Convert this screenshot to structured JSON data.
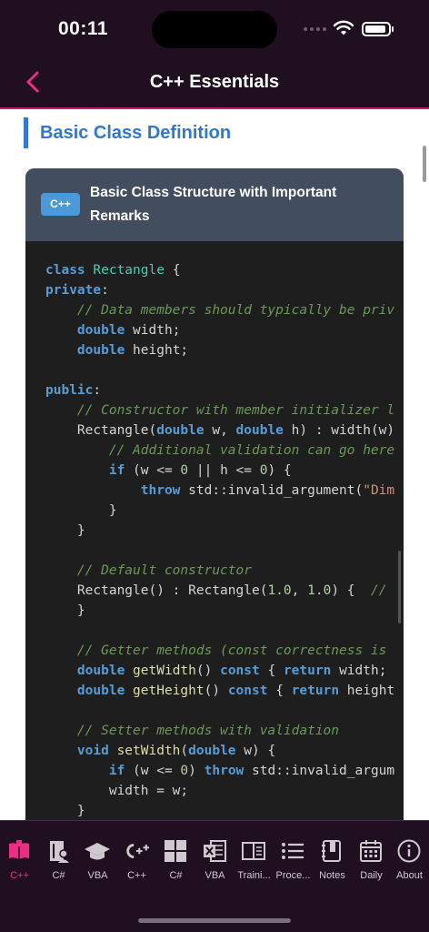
{
  "status": {
    "time": "00:11"
  },
  "nav": {
    "title": "C++ Essentials"
  },
  "section": {
    "title": "Basic Class Definition"
  },
  "card": {
    "badge": "C++",
    "title": "Basic Class Structure with Important Remarks"
  },
  "code_lines": [
    "class Rectangle {",
    "private:",
    "    // Data members should typically be priv",
    "    double width;",
    "    double height;",
    "",
    "public:",
    "    // Constructor with member initializer l",
    "    Rectangle(double w, double h) : width(w)",
    "        // Additional validation can go here",
    "        if (w <= 0 || h <= 0) {",
    "            throw std::invalid_argument(\"Dim",
    "        }",
    "    }",
    "",
    "    // Default constructor",
    "    Rectangle() : Rectangle(1.0, 1.0) {  //",
    "    }",
    "",
    "    // Getter methods (const correctness is",
    "    double getWidth() const { return width;",
    "    double getHeight() const { return height",
    "",
    "    // Setter methods with validation",
    "    void setWidth(double w) {",
    "        if (w <= 0) throw std::invalid_argum",
    "        width = w;",
    "    }"
  ],
  "fab": {
    "icon": "arrow-up-icon",
    "glyph": "↑"
  },
  "tabs": [
    {
      "label": "C++",
      "icon": "book-open-icon",
      "active": true
    },
    {
      "label": "C#",
      "icon": "book-person-icon"
    },
    {
      "label": "VBA",
      "icon": "graduation-cap-icon"
    },
    {
      "label": "C++",
      "icon": "cpp-plus-icon"
    },
    {
      "label": "C#",
      "icon": "windows-grid-icon"
    },
    {
      "label": "VBA",
      "icon": "excel-icon"
    },
    {
      "label": "Traini...",
      "icon": "book-columns-icon"
    },
    {
      "label": "Proce...",
      "icon": "list-icon"
    },
    {
      "label": "Notes",
      "icon": "notebook-icon"
    },
    {
      "label": "Daily",
      "icon": "calendar-icon"
    },
    {
      "label": "About",
      "icon": "info-icon"
    }
  ],
  "colors": {
    "accent": "#ee2c86",
    "header_bg": "#1f0f20",
    "link_blue": "#2f78d2"
  }
}
